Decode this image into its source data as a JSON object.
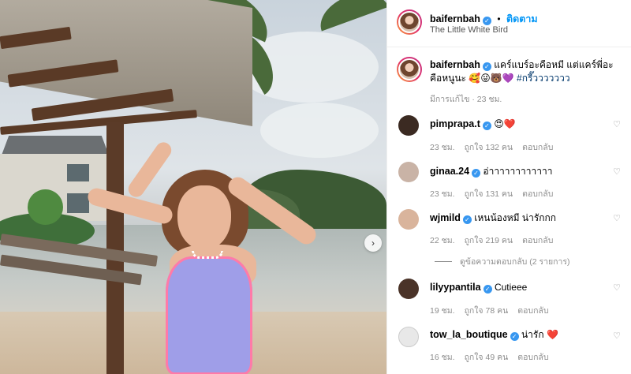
{
  "post": {
    "author": "baifernbah",
    "follow_label": "ติดตาม",
    "separator": "•",
    "location": "The Little White Bird",
    "verified_icon": "✓"
  },
  "caption": {
    "username": "baifernbah",
    "text": "แคร์แบร์อะคือหมี แต่แคร์พี่อะคือหนูนะ 🥰😜🐻💜",
    "hashtag": "#กรี๊ววววววว",
    "edited": "มีการแก้ไข · 23 ชม."
  },
  "comments": [
    {
      "username": "pimprapa.t",
      "text": "😍❤️",
      "age": "23 ชม.",
      "likes": "ถูกใจ 132 คน",
      "reply": "ตอบกลับ",
      "avatar_color": "#3b2a22"
    },
    {
      "username": "ginaa.24",
      "text": "อ่าาาาาาาาาาาา",
      "age": "23 ชม.",
      "likes": "ถูกใจ 131 คน",
      "reply": "ตอบกลับ",
      "avatar_color": "#c9b3a6"
    },
    {
      "username": "wjmild",
      "text": "เหนน้องหมี น่ารักกก",
      "age": "22 ชม.",
      "likes": "ถูกใจ 219 คน",
      "reply": "ตอบกลับ",
      "avatar_color": "#d9b49c"
    },
    {
      "username": "lilyypantila",
      "text": "Cutieee",
      "age": "19 ชม.",
      "likes": "ถูกใจ 78 คน",
      "reply": "ตอบกลับ",
      "avatar_color": "#4a3328"
    },
    {
      "username": "tow_la_boutique",
      "text": "น่ารัก ❤️",
      "age": "16 ชม.",
      "likes": "ถูกใจ 49 คน",
      "reply": "ตอบกลับ",
      "avatar_color": "#e8e8e8"
    }
  ],
  "view_replies": "ดูข้อความตอบกลับ (2 รายการ)",
  "icons": {
    "heart": "♡",
    "next": "›"
  },
  "colors": {
    "link_blue": "#0095f6",
    "verified_blue": "#3897f0",
    "hashtag": "#00376b",
    "muted": "#8e8e8e"
  }
}
